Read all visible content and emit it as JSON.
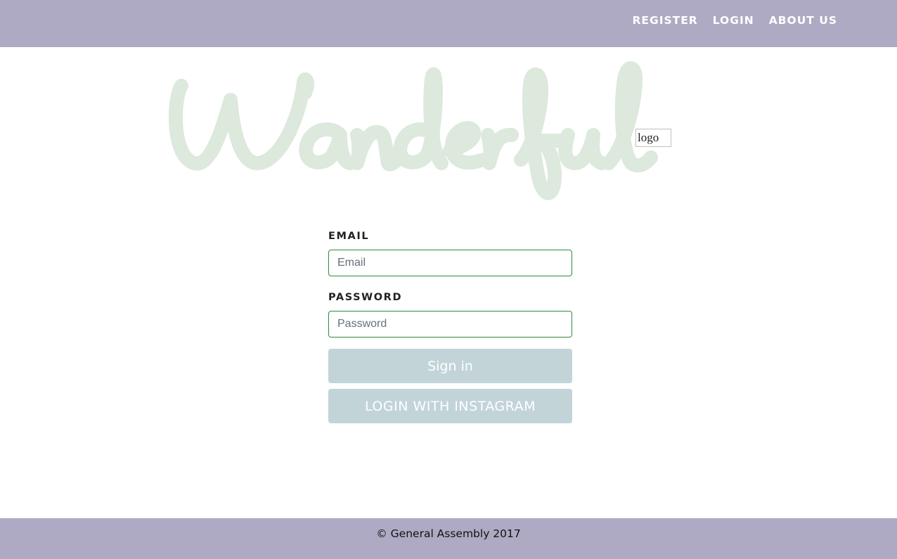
{
  "nav": {
    "links": [
      {
        "label": "REGISTER"
      },
      {
        "label": "LOGIN"
      },
      {
        "label": "ABOUT US"
      }
    ]
  },
  "header": {
    "wordmark": "Wanderful",
    "logo_alt": "logo"
  },
  "form": {
    "email_label": "EMAIL",
    "email_placeholder": "Email",
    "email_value": "",
    "password_label": "PASSWORD",
    "password_placeholder": "Password",
    "password_value": "",
    "sign_in_label": "Sign in",
    "instagram_label": "LOGIN WITH INSTAGRAM"
  },
  "footer": {
    "text": "© General Assembly 2017"
  },
  "colors": {
    "bar": "#afaac3",
    "wordmark": "#dce9dc",
    "button": "#c2d4d8",
    "input_border": "#2e8b3a"
  }
}
